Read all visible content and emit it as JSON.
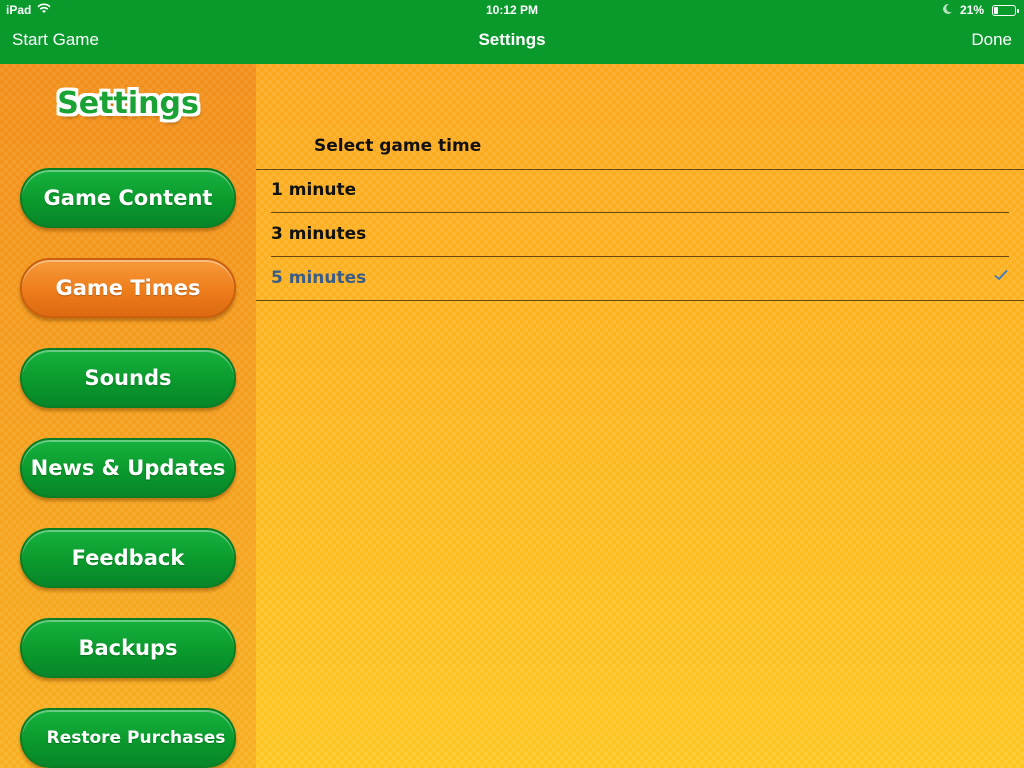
{
  "status": {
    "device": "iPad",
    "time": "10:12 PM",
    "battery": "21%",
    "battery_level": 0.21
  },
  "nav": {
    "left": "Start Game",
    "title": "Settings",
    "right": "Done"
  },
  "sidebar": {
    "title": "Settings",
    "items": [
      {
        "label": "Game Content"
      },
      {
        "label": "Game Times"
      },
      {
        "label": "Sounds"
      },
      {
        "label": "News & Updates"
      },
      {
        "label": "Feedback"
      },
      {
        "label": "Backups"
      },
      {
        "label": "Restore Purchases"
      }
    ]
  },
  "main": {
    "header": "Select game time",
    "options": [
      {
        "label": "1 minute"
      },
      {
        "label": "3 minutes"
      },
      {
        "label": "5 minutes"
      }
    ],
    "selected_index": 2
  },
  "colors": {
    "bar": "#0a9a2c",
    "active_button": "#ee7d1b",
    "button": "#0a9a2c",
    "selected_text": "#3b5c86",
    "checkmark": "#3b79c2"
  }
}
